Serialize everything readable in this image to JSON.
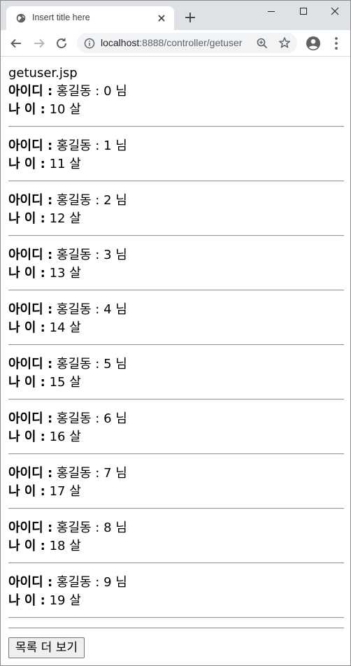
{
  "browser": {
    "tab_title": "Insert title here",
    "new_tab": "+",
    "url_host": "localhost",
    "url_path": ":8888/controller/getuser"
  },
  "page": {
    "heading": "getuser.jsp",
    "id_label": "아이디 :",
    "age_label": "나 이 :",
    "users": [
      {
        "id": "홍길동 : 0 님",
        "age": "10 살"
      },
      {
        "id": "홍길동 : 1 님",
        "age": "11 살"
      },
      {
        "id": "홍길동 : 2 님",
        "age": "12 살"
      },
      {
        "id": "홍길동 : 3 님",
        "age": "13 살"
      },
      {
        "id": "홍길동 : 4 님",
        "age": "14 살"
      },
      {
        "id": "홍길동 : 5 님",
        "age": "15 살"
      },
      {
        "id": "홍길동 : 6 님",
        "age": "16 살"
      },
      {
        "id": "홍길동 : 7 님",
        "age": "17 살"
      },
      {
        "id": "홍길동 : 8 님",
        "age": "18 살"
      },
      {
        "id": "홍길동 : 9 님",
        "age": "19 살"
      }
    ],
    "more_button": "목록 더 보기"
  }
}
